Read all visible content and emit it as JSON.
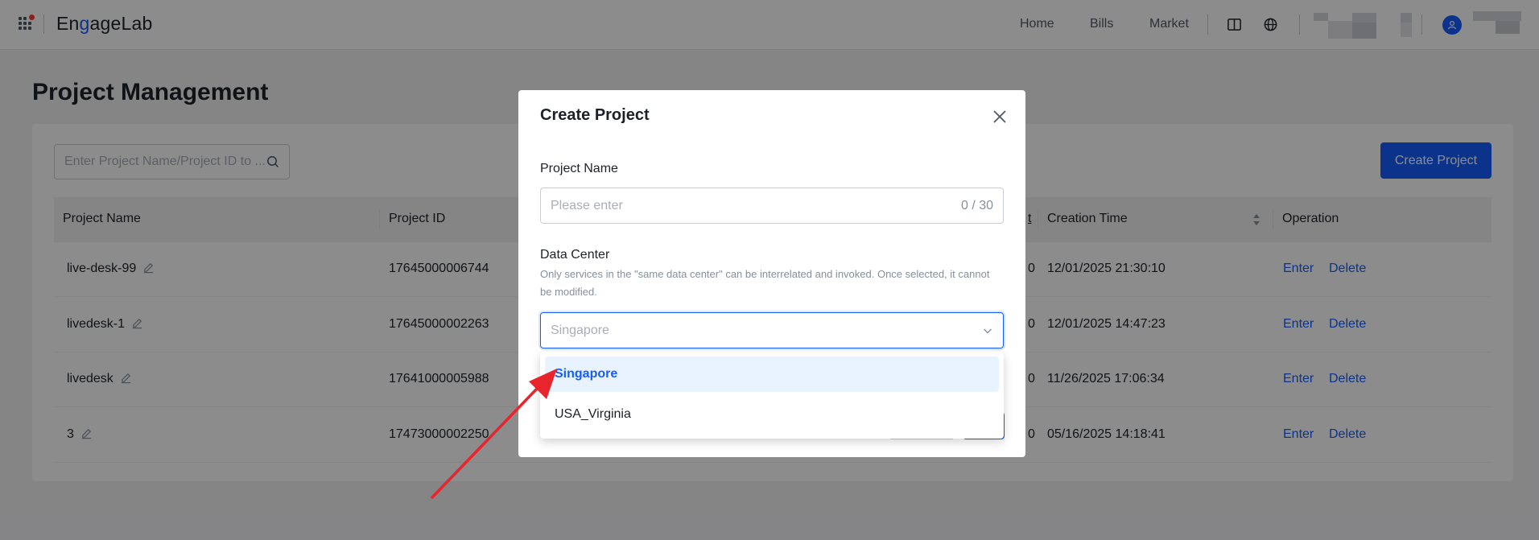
{
  "topbar": {
    "brand": "EngageLab",
    "nav": [
      "Home",
      "Bills",
      "Market"
    ]
  },
  "page": {
    "title": "Project Management",
    "search_placeholder": "Enter Project Name/Project ID to ...",
    "create_button": "Create Project"
  },
  "table": {
    "headers": {
      "name": "Project Name",
      "id": "Project ID",
      "count_fragment": "t",
      "created": "Creation Time",
      "operation": "Operation"
    },
    "rows": [
      {
        "name": "live-desk-99",
        "id": "17645000006744",
        "count": "0",
        "created": "12/01/2025 21:30:10",
        "enter": "Enter",
        "delete": "Delete"
      },
      {
        "name": "livedesk-1",
        "id": "17645000002263",
        "count": "0",
        "created": "12/01/2025 14:47:23",
        "enter": "Enter",
        "delete": "Delete"
      },
      {
        "name": "livedesk",
        "id": "17641000005988",
        "count": "0",
        "created": "11/26/2025 17:06:34",
        "enter": "Enter",
        "delete": "Delete"
      },
      {
        "name": "3",
        "id": "17473000002250",
        "count": "0",
        "created": "05/16/2025 14:18:41",
        "enter": "Enter",
        "delete": "Delete"
      }
    ]
  },
  "modal": {
    "title": "Create Project",
    "project_name_label": "Project Name",
    "project_name_placeholder": "Please enter",
    "char_count": "0 / 30",
    "data_center_label": "Data Center",
    "data_center_hint": "Only services in the \"same data center\" can be interrelated and invoked. Once selected, it cannot be modified.",
    "data_center_placeholder": "Singapore",
    "options": [
      "Singapore",
      "USA_Virginia"
    ],
    "selected_option": "Singapore"
  },
  "colors": {
    "primary": "#165dff",
    "arrow": "#e8242c"
  }
}
